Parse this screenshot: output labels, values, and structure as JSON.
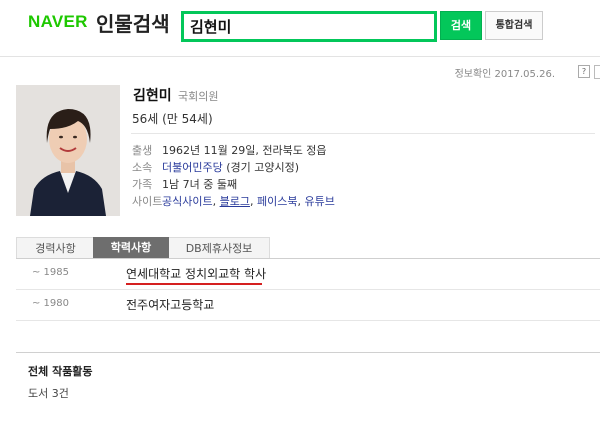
{
  "header": {
    "logo_brand": "NAVER",
    "logo_service": "인물검색",
    "search_value": "김현미",
    "search_button": "검색",
    "total_search_button": "통합검색"
  },
  "confirm_text": "정보확인 2017.05.26.",
  "help_label": "?",
  "person": {
    "name": "김현미",
    "role": "국회의원",
    "age": "56세 (만 54세)",
    "birth_label": "출생",
    "birth_value": "1962년 11월 29일, 전라북도 정읍",
    "affiliation_label": "소속",
    "affiliation_party": "더불어민주당",
    "affiliation_district": " (경기 고양시정)",
    "family_label": "가족",
    "family_value": "1남 7녀 중 둘째",
    "site_label": "사이트",
    "sites": [
      "공식사이트",
      "블로그",
      "페이스북",
      "유튜브"
    ],
    "site_sep": ", "
  },
  "tabs": [
    "경력사항",
    "학력사항",
    "DB제휴사정보"
  ],
  "education": [
    {
      "year": "~ 1985",
      "school": "연세대학교 정치외교학 학사"
    },
    {
      "year": "~ 1980",
      "school": "전주여자고등학교"
    }
  ],
  "works": {
    "title": "전체 작품활동",
    "value": "도서 3건"
  },
  "colors": {
    "naver_green": "#1ec800",
    "search_green": "#03c75a",
    "active_tab": "#6e6e6e",
    "link": "#2a3b9b",
    "highlight_underline": "#d52020"
  }
}
